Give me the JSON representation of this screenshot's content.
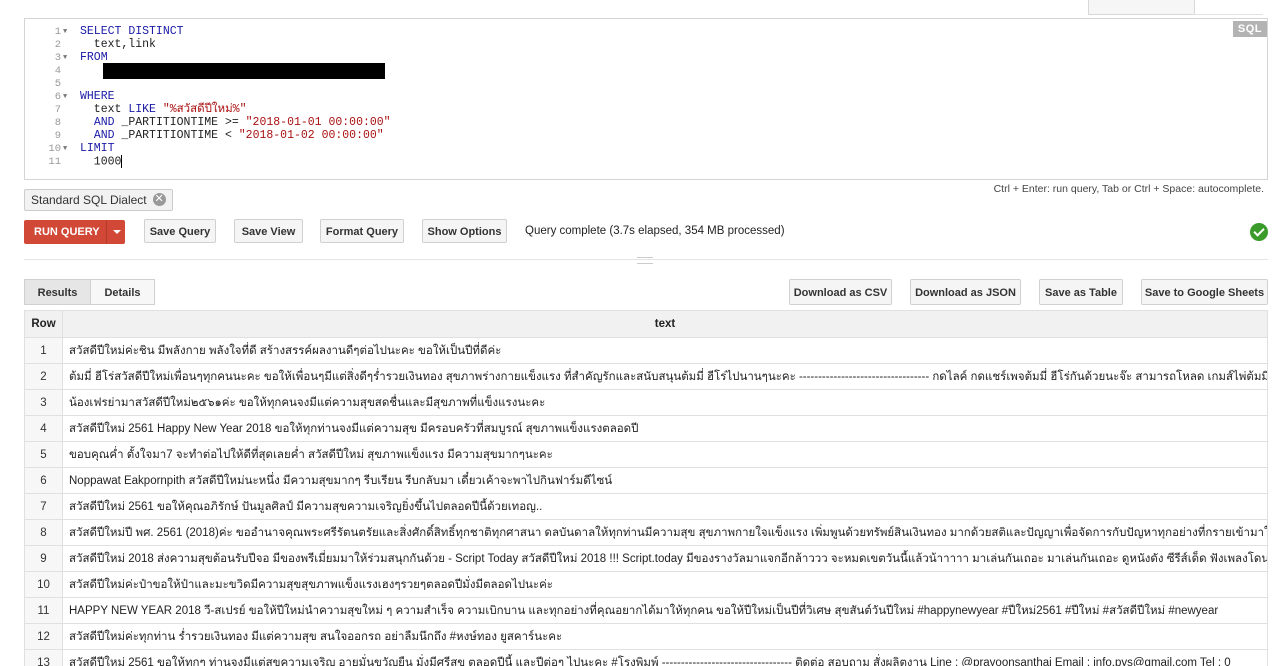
{
  "editor": {
    "badge": "SQL",
    "lines": [
      {
        "n": "1",
        "fold": true,
        "code": "SELECT DISTINCT"
      },
      {
        "n": "2",
        "fold": false,
        "code": "  text,link"
      },
      {
        "n": "3",
        "fold": true,
        "code": "FROM"
      },
      {
        "n": "4",
        "fold": false,
        "code": ""
      },
      {
        "n": "5",
        "fold": false,
        "code": ""
      },
      {
        "n": "6",
        "fold": true,
        "code": "WHERE"
      },
      {
        "n": "7",
        "fold": false,
        "code": "  text LIKE \"%สวัสดีปีใหม่%\""
      },
      {
        "n": "8",
        "fold": false,
        "code": "  AND _PARTITIONTIME >= \"2018-01-01 00:00:00\""
      },
      {
        "n": "9",
        "fold": false,
        "code": "  AND _PARTITIONTIME < \"2018-01-02 00:00:00\""
      },
      {
        "n": "10",
        "fold": true,
        "code": "LIMIT"
      },
      {
        "n": "11",
        "fold": false,
        "code": "  1000"
      }
    ]
  },
  "dialect_chip": "Standard SQL Dialect",
  "hint": "Ctrl + Enter: run query, Tab or Ctrl + Space: autocomplete.",
  "toolbar": {
    "run": "RUN QUERY",
    "save_query": "Save Query",
    "save_view": "Save View",
    "format_query": "Format Query",
    "show_options": "Show Options",
    "status": "Query complete (3.7s elapsed, 354 MB processed)"
  },
  "tabs": {
    "results": "Results",
    "details": "Details"
  },
  "downloads": {
    "csv": "Download as CSV",
    "json": "Download as JSON",
    "table": "Save as Table",
    "sheets": "Save to Google Sheets"
  },
  "table": {
    "headers": [
      "Row",
      "text"
    ],
    "rows": [
      {
        "row": "1",
        "text": "สวัสดีปีใหม่ค่ะชิน มีพลังกาย พลังใจที่ดี สร้างสรรค์ผลงานดีๆต่อไปนะคะ ขอให้เป็นปีที่ดีค่ะ"
      },
      {
        "row": "2",
        "text": "ต้มมี่ ฮีโร่สวัสดีปีใหม่เพื่อนๆทุกคนนะคะ ขอให้เพื่อนๆมีแต่สิ่งดีๆร่ำรวยเงินทอง สุขภาพร่างกายแข็งแรง ที่สำคัญรักและสนับสนุนต้มมี่ ฮีโร่ไปนานๆนะคะ ---------------------------------- กดไลค์ กดแชร์เพจต้มมี่ ฮีโร่กันด้วยนะจ๊ะ สามารถโหลด เกมส์ไพ่ต้มมี่"
      },
      {
        "row": "3",
        "text": "น้องเฟรย่ามาสวัสดีปีใหม่๒๕๖๑ค่ะ ขอให้ทุกคนจงมีแต่ความสุขสดชื่นและมีสุขภาพที่แข็งแรงนะคะ"
      },
      {
        "row": "4",
        "text": "สวัสดีปีใหม่ 2561 Happy New Year 2018 ขอให้ทุกท่านจงมีแต่ความสุข มีครอบครัวที่สมบูรณ์ สุขภาพแข็งแรงตลอดปี"
      },
      {
        "row": "5",
        "text": "ขอบคุณค่ำ ตั้งใจมา7 จะทำต่อไปให้ดีที่สุดเลยค่ำ สวัสดีปีใหม่ สุขภาพแข็งแรง มีความสุขมากๆนะคะ"
      },
      {
        "row": "6",
        "text": "Noppawat Eakpornpith สวัสดีปีใหม่นะหนึ่ง มีความสุขมากๆ รีบเรียน รีบกลับมา เดี๋ยวเค้าจะพาไปกินฟาร์มดีไซน์"
      },
      {
        "row": "7",
        "text": "สวัสดีปีใหม่ 2561 ขอให้คุณอภิรักษ์ ปันมูลศิลป์ มีความสุขความเจริญยิ่งขึ้นไปตลอดปีนี้ด้วยเทอญ.."
      },
      {
        "row": "8",
        "text": "สวัสดีปีใหม่ปี พศ. 2561 (2018)ค่ะ ขออำนาจคุณพระศรีรัตนตรัยและสิ่งศักดิ์สิทธิ์ทุกชาติทุกศาสนา ดลบันดาลให้ทุกท่านมีความสุข สุขภาพกายใจแข็งแรง เพิ่มพูนด้วยทรัพย์สินเงินทอง มากด้วยสติและปัญญาเพื่อจัดการกับปัญหาทุกอย่างที่กรายเข้ามาใน"
      },
      {
        "row": "9",
        "text": "สวัสดีปีใหม่ 2018 ส่งความสุขต้อนรับปีจอ มีของพรีเมี่ยมมาให้ร่วมสนุกกันด้วย - Script Today สวัสดีปีใหม่ 2018 !!! Script.today มีของรางวัลมาแจกอีกล้าววว จะหมดเขตวันนี้แล้วน้าาาาา มาเล่นกันเถอะ มาเล่นกันเถอะ ดูหนังดัง ซีรีส์เด็ด ฟังเพลงโดน"
      },
      {
        "row": "10",
        "text": "สวัสดีปีใหม่ค่ะป๋าขอให้ป๋าและมะขวิดมีความสุขสุขภาพแข็งแรงเฮงๆรวยๆตลอดปีมั่งมีตลอดไปนะค่ะ"
      },
      {
        "row": "11",
        "text": "HAPPY NEW YEAR 2018 วี-สเปรย์ ขอให้ปีใหม่นำความสุขใหม่ ๆ ความสำเร็จ ความเบิกบาน และทุกอย่างที่คุณอยากได้มาให้ทุกคน ขอให้ปีใหม่เป็นปีที่วิเศษ สุขสันต์วันปีใหม่ #happynewyear #ปีใหม่2561 #ปีใหม่ #สวัสดีปีใหม่ #newyear"
      },
      {
        "row": "12",
        "text": "สวัสดีปีใหม่ค่ะทุกท่าน ร่ำรวยเงินทอง มีแต่ความสุข สนใจออกรถ อย่าลืมนึกถึง #หงษ์ทอง ยูสคาร์นะคะ"
      },
      {
        "row": "13",
        "text": "สวัสดีปีใหม่ 2561 ขอให้ทุกๆ ท่านจงมีแต่สุขความเจริญ อายุมั่นขวัญยืน มั่งมีศรีสุข ตลอดปีนี้ และปีต่อๆ ไปนะคะ #โรงพิมพ์ ---------------------------------- ติดต่อ สอบถาม สั่งผลิตงาน Line : @prayoonsanthai Email : info.pys@gmail.com Tel : 0"
      }
    ]
  }
}
